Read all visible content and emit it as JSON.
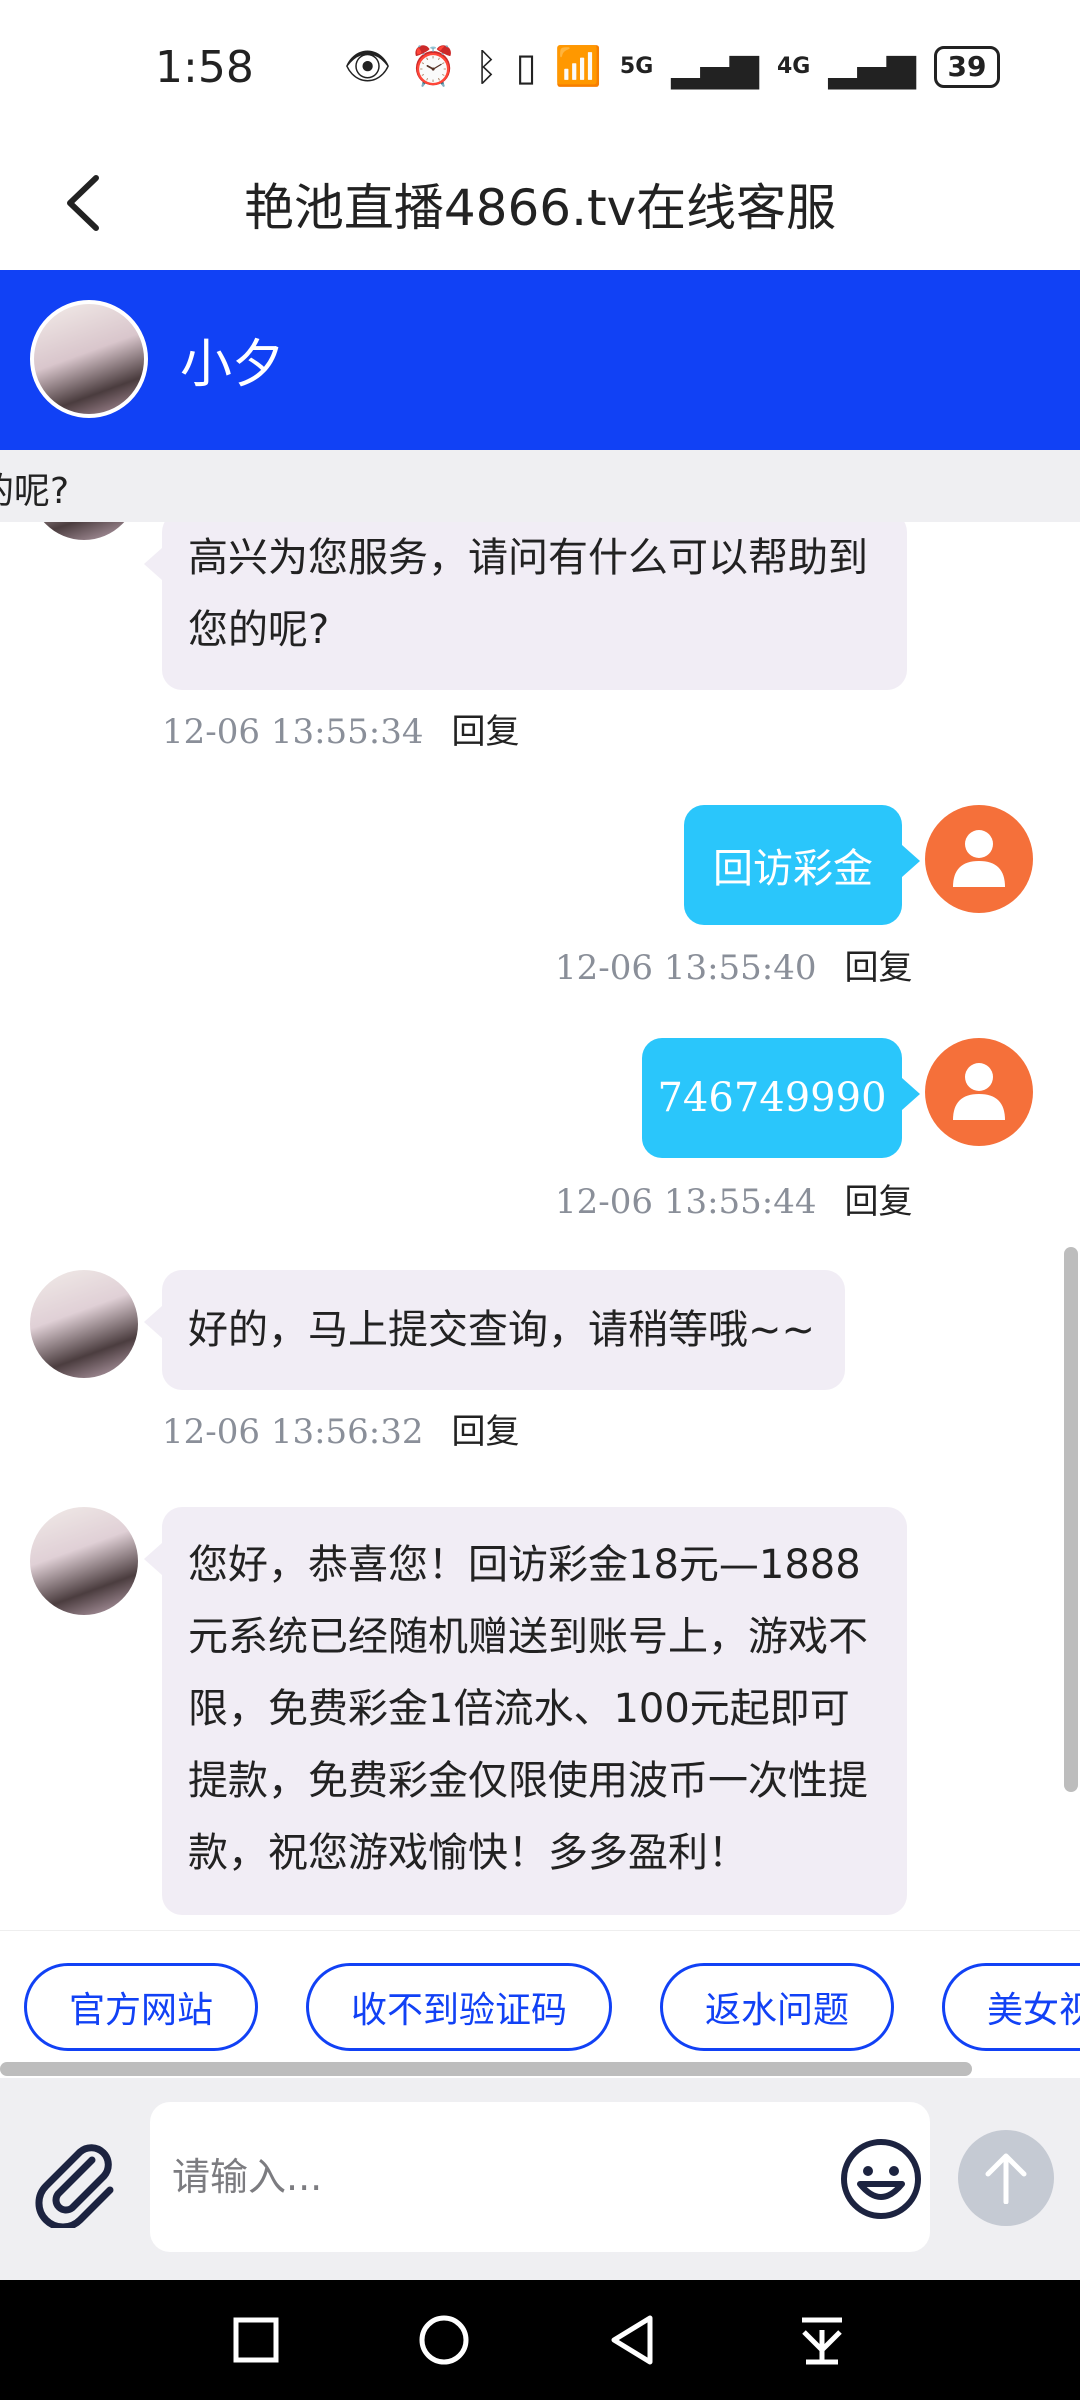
{
  "status_bar": {
    "time": "1:58",
    "battery": "39",
    "net1": "5G",
    "net2": "4G"
  },
  "nav": {
    "title": "艳池直播4866.tv在线客服"
  },
  "agent": {
    "name": "小夕"
  },
  "notice": {
    "text": "的呢?"
  },
  "messages": [
    {
      "side": "in",
      "text": "高兴为您服务，请问有什么可以帮助到您的呢?",
      "time": "12-06 13:55:34",
      "reply": "回复"
    },
    {
      "side": "out",
      "text": "回访彩金",
      "time": "12-06 13:55:40",
      "reply": "回复"
    },
    {
      "side": "out",
      "text": "746749990",
      "time": "12-06 13:55:44",
      "reply": "回复"
    },
    {
      "side": "in",
      "text": "好的，马上提交查询，请稍等哦~~",
      "time": "12-06 13:56:32",
      "reply": "回复"
    },
    {
      "side": "in",
      "text": "您好，恭喜您！回访彩金18元—1888元系统已经随机赠送到账号上，游戏不限，免费彩金1倍流水、100元起即可提款，免费彩金仅限使用波币一次性提款，祝您游戏愉快！多多盈利！"
    }
  ],
  "quick_replies": [
    "官方网站",
    "收不到验证码",
    "返水问题",
    "美女视"
  ],
  "input": {
    "placeholder": "请输入..."
  },
  "colors": {
    "brand": "#1141f5",
    "outgoing": "#2ac6fb",
    "incoming": "#f1edf5",
    "user_avatar": "#f5703a"
  }
}
